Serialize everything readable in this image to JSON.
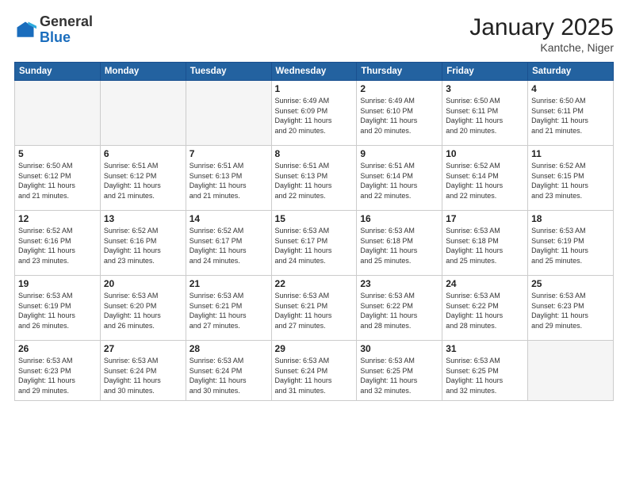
{
  "header": {
    "logo_general": "General",
    "logo_blue": "Blue",
    "title": "January 2025",
    "subtitle": "Kantche, Niger"
  },
  "days_of_week": [
    "Sunday",
    "Monday",
    "Tuesday",
    "Wednesday",
    "Thursday",
    "Friday",
    "Saturday"
  ],
  "weeks": [
    [
      {
        "day": "",
        "info": ""
      },
      {
        "day": "",
        "info": ""
      },
      {
        "day": "",
        "info": ""
      },
      {
        "day": "1",
        "info": "Sunrise: 6:49 AM\nSunset: 6:09 PM\nDaylight: 11 hours and 20 minutes."
      },
      {
        "day": "2",
        "info": "Sunrise: 6:49 AM\nSunset: 6:10 PM\nDaylight: 11 hours and 20 minutes."
      },
      {
        "day": "3",
        "info": "Sunrise: 6:50 AM\nSunset: 6:11 PM\nDaylight: 11 hours and 20 minutes."
      },
      {
        "day": "4",
        "info": "Sunrise: 6:50 AM\nSunset: 6:11 PM\nDaylight: 11 hours and 21 minutes."
      }
    ],
    [
      {
        "day": "5",
        "info": "Sunrise: 6:50 AM\nSunset: 6:12 PM\nDaylight: 11 hours and 21 minutes."
      },
      {
        "day": "6",
        "info": "Sunrise: 6:51 AM\nSunset: 6:12 PM\nDaylight: 11 hours and 21 minutes."
      },
      {
        "day": "7",
        "info": "Sunrise: 6:51 AM\nSunset: 6:13 PM\nDaylight: 11 hours and 21 minutes."
      },
      {
        "day": "8",
        "info": "Sunrise: 6:51 AM\nSunset: 6:13 PM\nDaylight: 11 hours and 22 minutes."
      },
      {
        "day": "9",
        "info": "Sunrise: 6:51 AM\nSunset: 6:14 PM\nDaylight: 11 hours and 22 minutes."
      },
      {
        "day": "10",
        "info": "Sunrise: 6:52 AM\nSunset: 6:14 PM\nDaylight: 11 hours and 22 minutes."
      },
      {
        "day": "11",
        "info": "Sunrise: 6:52 AM\nSunset: 6:15 PM\nDaylight: 11 hours and 23 minutes."
      }
    ],
    [
      {
        "day": "12",
        "info": "Sunrise: 6:52 AM\nSunset: 6:16 PM\nDaylight: 11 hours and 23 minutes."
      },
      {
        "day": "13",
        "info": "Sunrise: 6:52 AM\nSunset: 6:16 PM\nDaylight: 11 hours and 23 minutes."
      },
      {
        "day": "14",
        "info": "Sunrise: 6:52 AM\nSunset: 6:17 PM\nDaylight: 11 hours and 24 minutes."
      },
      {
        "day": "15",
        "info": "Sunrise: 6:53 AM\nSunset: 6:17 PM\nDaylight: 11 hours and 24 minutes."
      },
      {
        "day": "16",
        "info": "Sunrise: 6:53 AM\nSunset: 6:18 PM\nDaylight: 11 hours and 25 minutes."
      },
      {
        "day": "17",
        "info": "Sunrise: 6:53 AM\nSunset: 6:18 PM\nDaylight: 11 hours and 25 minutes."
      },
      {
        "day": "18",
        "info": "Sunrise: 6:53 AM\nSunset: 6:19 PM\nDaylight: 11 hours and 25 minutes."
      }
    ],
    [
      {
        "day": "19",
        "info": "Sunrise: 6:53 AM\nSunset: 6:19 PM\nDaylight: 11 hours and 26 minutes."
      },
      {
        "day": "20",
        "info": "Sunrise: 6:53 AM\nSunset: 6:20 PM\nDaylight: 11 hours and 26 minutes."
      },
      {
        "day": "21",
        "info": "Sunrise: 6:53 AM\nSunset: 6:21 PM\nDaylight: 11 hours and 27 minutes."
      },
      {
        "day": "22",
        "info": "Sunrise: 6:53 AM\nSunset: 6:21 PM\nDaylight: 11 hours and 27 minutes."
      },
      {
        "day": "23",
        "info": "Sunrise: 6:53 AM\nSunset: 6:22 PM\nDaylight: 11 hours and 28 minutes."
      },
      {
        "day": "24",
        "info": "Sunrise: 6:53 AM\nSunset: 6:22 PM\nDaylight: 11 hours and 28 minutes."
      },
      {
        "day": "25",
        "info": "Sunrise: 6:53 AM\nSunset: 6:23 PM\nDaylight: 11 hours and 29 minutes."
      }
    ],
    [
      {
        "day": "26",
        "info": "Sunrise: 6:53 AM\nSunset: 6:23 PM\nDaylight: 11 hours and 29 minutes."
      },
      {
        "day": "27",
        "info": "Sunrise: 6:53 AM\nSunset: 6:24 PM\nDaylight: 11 hours and 30 minutes."
      },
      {
        "day": "28",
        "info": "Sunrise: 6:53 AM\nSunset: 6:24 PM\nDaylight: 11 hours and 30 minutes."
      },
      {
        "day": "29",
        "info": "Sunrise: 6:53 AM\nSunset: 6:24 PM\nDaylight: 11 hours and 31 minutes."
      },
      {
        "day": "30",
        "info": "Sunrise: 6:53 AM\nSunset: 6:25 PM\nDaylight: 11 hours and 32 minutes."
      },
      {
        "day": "31",
        "info": "Sunrise: 6:53 AM\nSunset: 6:25 PM\nDaylight: 11 hours and 32 minutes."
      },
      {
        "day": "",
        "info": ""
      }
    ]
  ]
}
